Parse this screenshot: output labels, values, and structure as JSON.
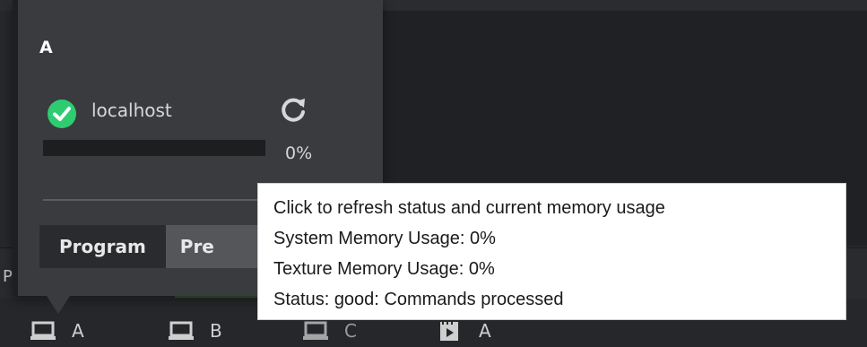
{
  "popover": {
    "title": "A",
    "host": "localhost",
    "status": "good",
    "memory_percent_label": "0%",
    "memory_fraction": 0,
    "tabs": [
      {
        "label": "Program",
        "selected": true
      },
      {
        "label": "Pre",
        "selected": false
      }
    ]
  },
  "background": {
    "strip_label": "P"
  },
  "bottom_bar": {
    "items": [
      {
        "label": "A",
        "icon": "monitor-icon"
      },
      {
        "label": "B",
        "icon": "monitor-icon"
      },
      {
        "label": "C",
        "icon": "monitor-icon"
      },
      {
        "label": "A",
        "icon": "film-play-icon"
      }
    ]
  },
  "tooltip": {
    "lines": [
      "Click to refresh status and current memory usage",
      "System Memory Usage: 0%",
      "Texture Memory Usage: 0%",
      "Status: good: Commands processed"
    ]
  },
  "colors": {
    "status_ok": "#2ecc71",
    "progress_track": "#1d1e20",
    "popover_bg": "#3a3b3e",
    "tooltip_bg": "#ffffff"
  }
}
